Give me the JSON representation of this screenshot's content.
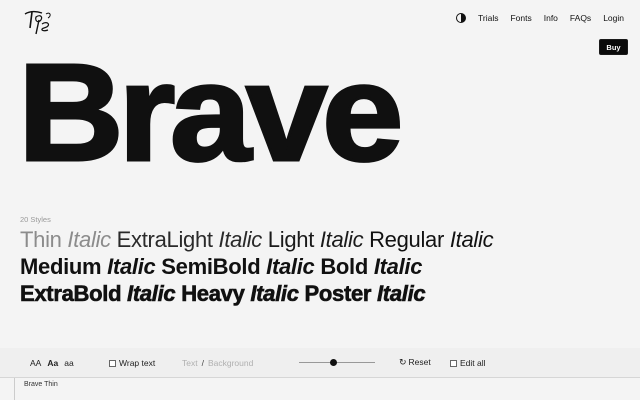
{
  "nav": {
    "theme_icon": "contrast-icon",
    "items": [
      "Trials",
      "Fonts",
      "Info",
      "FAQs",
      "Login"
    ]
  },
  "buy_label": "Buy",
  "hero_text": "Brave",
  "styles_count": "20 Styles",
  "styles": {
    "line1": [
      "Thin",
      "Italic",
      "ExtraLight",
      "Italic",
      "Light",
      "Italic",
      "Regular",
      "Italic"
    ],
    "line2": [
      "Medium",
      "Italic",
      "SemiBold",
      "Italic",
      "Bold",
      "Italic"
    ],
    "line3": [
      "ExtraBold",
      "Italic",
      "Heavy",
      "Italic",
      "Poster",
      "Italic"
    ]
  },
  "toolbar": {
    "case_options": [
      "AA",
      "Aa",
      "aa"
    ],
    "wrap_text": "Wrap text",
    "text_label": "Text",
    "separator": "/",
    "background_label": "Background",
    "reset_label": "Reset",
    "edit_all_label": "Edit all"
  },
  "bottom_label": "Brave Thin",
  "colors": {
    "buy_bg": "#0b0b0b",
    "buy_text": "#ffffff",
    "hero": "#101010"
  }
}
